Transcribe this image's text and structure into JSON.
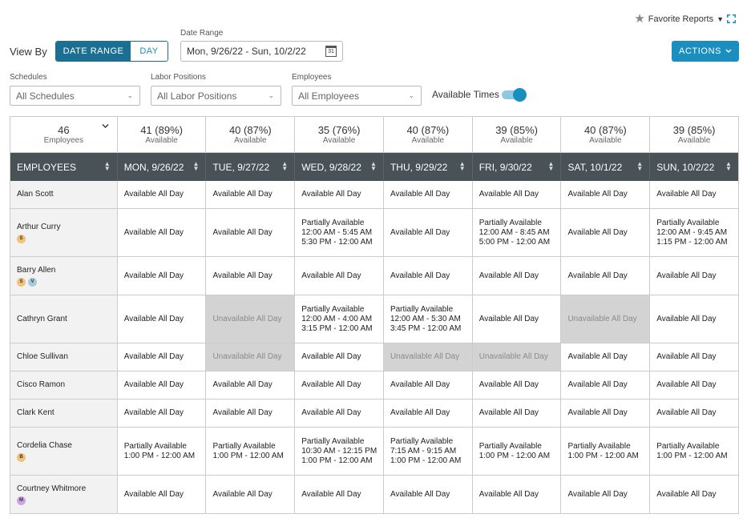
{
  "toolbar": {
    "favorite_reports": "Favorite Reports",
    "view_by_label": "View By",
    "view_date_range": "DATE RANGE",
    "view_day": "DAY",
    "date_range_label": "Date Range",
    "date_range_value": "Mon, 9/26/22 - Sun, 10/2/22",
    "calendar_day": "31",
    "actions_label": "ACTIONS"
  },
  "filters": {
    "schedules_label": "Schedules",
    "schedules_value": "All Schedules",
    "labor_label": "Labor Positions",
    "labor_value": "All Labor Positions",
    "employees_label": "Employees",
    "employees_value": "All Employees",
    "available_times_label": "Available Times",
    "available_times_on": true
  },
  "summary": [
    {
      "big": "46",
      "small": "Employees"
    },
    {
      "big": "41 (89%)",
      "small": "Available"
    },
    {
      "big": "40 (87%)",
      "small": "Available"
    },
    {
      "big": "35 (76%)",
      "small": "Available"
    },
    {
      "big": "40 (87%)",
      "small": "Available"
    },
    {
      "big": "39 (85%)",
      "small": "Available"
    },
    {
      "big": "40 (87%)",
      "small": "Available"
    },
    {
      "big": "39 (85%)",
      "small": "Available"
    }
  ],
  "columns": [
    "EMPLOYEES",
    "MON, 9/26/22",
    "TUE, 9/27/22",
    "WED, 9/28/22",
    "THU, 9/29/22",
    "FRI, 9/30/22",
    "SAT, 10/1/22",
    "SUN, 10/2/22"
  ],
  "rows": [
    {
      "name": "Alan Scott",
      "badges": [],
      "days": [
        [
          "Available All Day"
        ],
        [
          "Available All Day"
        ],
        [
          "Available All Day"
        ],
        [
          "Available All Day"
        ],
        [
          "Available All Day"
        ],
        [
          "Available All Day"
        ],
        [
          "Available All Day"
        ]
      ]
    },
    {
      "name": "Arthur Curry",
      "badges": [
        "S"
      ],
      "days": [
        [
          "Available All Day"
        ],
        [
          "Available All Day"
        ],
        [
          "Partially Available",
          "12:00 AM - 5:45 AM",
          "5:30 PM - 12:00 AM"
        ],
        [
          "Available All Day"
        ],
        [
          "Partially Available",
          "12:00 AM - 8:45 AM",
          "5:00 PM - 12:00 AM"
        ],
        [
          "Available All Day"
        ],
        [
          "Partially Available",
          "12:00 AM - 9:45 AM",
          "1:15 PM - 12:00 AM"
        ]
      ]
    },
    {
      "name": "Barry Allen",
      "badges": [
        "S",
        "V"
      ],
      "days": [
        [
          "Available All Day"
        ],
        [
          "Available All Day"
        ],
        [
          "Available All Day"
        ],
        [
          "Available All Day"
        ],
        [
          "Available All Day"
        ],
        [
          "Available All Day"
        ],
        [
          "Available All Day"
        ]
      ]
    },
    {
      "name": "Cathryn Grant",
      "badges": [],
      "days": [
        [
          "Available All Day"
        ],
        [
          "Unavailable All Day"
        ],
        [
          "Partially Available",
          "12:00 AM - 4:00 AM",
          "3:15 PM - 12:00 AM"
        ],
        [
          "Partially Available",
          "12:00 AM - 5:30 AM",
          "3:45 PM - 12:00 AM"
        ],
        [
          "Available All Day"
        ],
        [
          "Unavailable All Day"
        ],
        [
          "Available All Day"
        ]
      ]
    },
    {
      "name": "Chloe Sullivan",
      "badges": [],
      "days": [
        [
          "Available All Day"
        ],
        [
          "Unavailable All Day"
        ],
        [
          "Available All Day"
        ],
        [
          "Unavailable All Day"
        ],
        [
          "Unavailable All Day"
        ],
        [
          "Available All Day"
        ],
        [
          "Available All Day"
        ]
      ]
    },
    {
      "name": "Cisco Ramon",
      "badges": [],
      "days": [
        [
          "Available All Day"
        ],
        [
          "Available All Day"
        ],
        [
          "Available All Day"
        ],
        [
          "Available All Day"
        ],
        [
          "Available All Day"
        ],
        [
          "Available All Day"
        ],
        [
          "Available All Day"
        ]
      ]
    },
    {
      "name": "Clark Kent",
      "badges": [],
      "days": [
        [
          "Available All Day"
        ],
        [
          "Available All Day"
        ],
        [
          "Available All Day"
        ],
        [
          "Available All Day"
        ],
        [
          "Available All Day"
        ],
        [
          "Available All Day"
        ],
        [
          "Available All Day"
        ]
      ]
    },
    {
      "name": "Cordelia Chase",
      "badges": [
        "B"
      ],
      "days": [
        [
          "Partially Available",
          "1:00 PM - 12:00 AM"
        ],
        [
          "Partially Available",
          "1:00 PM - 12:00 AM"
        ],
        [
          "Partially Available",
          "10:30 AM - 12:15 PM",
          "1:00 PM - 12:00 AM"
        ],
        [
          "Partially Available",
          "7:15 AM - 9:15 AM",
          "1:00 PM - 12:00 AM"
        ],
        [
          "Partially Available",
          "1:00 PM - 12:00 AM"
        ],
        [
          "Partially Available",
          "1:00 PM - 12:00 AM"
        ],
        [
          "Partially Available",
          "1:00 PM - 12:00 AM"
        ]
      ]
    },
    {
      "name": "Courtney Whitmore",
      "badges": [
        "M"
      ],
      "days": [
        [
          "Available All Day"
        ],
        [
          "Available All Day"
        ],
        [
          "Available All Day"
        ],
        [
          "Available All Day"
        ],
        [
          "Available All Day"
        ],
        [
          "Available All Day"
        ],
        [
          "Available All Day"
        ]
      ]
    }
  ],
  "row_heights": [
    35,
    60,
    48,
    60,
    35,
    35,
    35,
    60,
    48
  ]
}
